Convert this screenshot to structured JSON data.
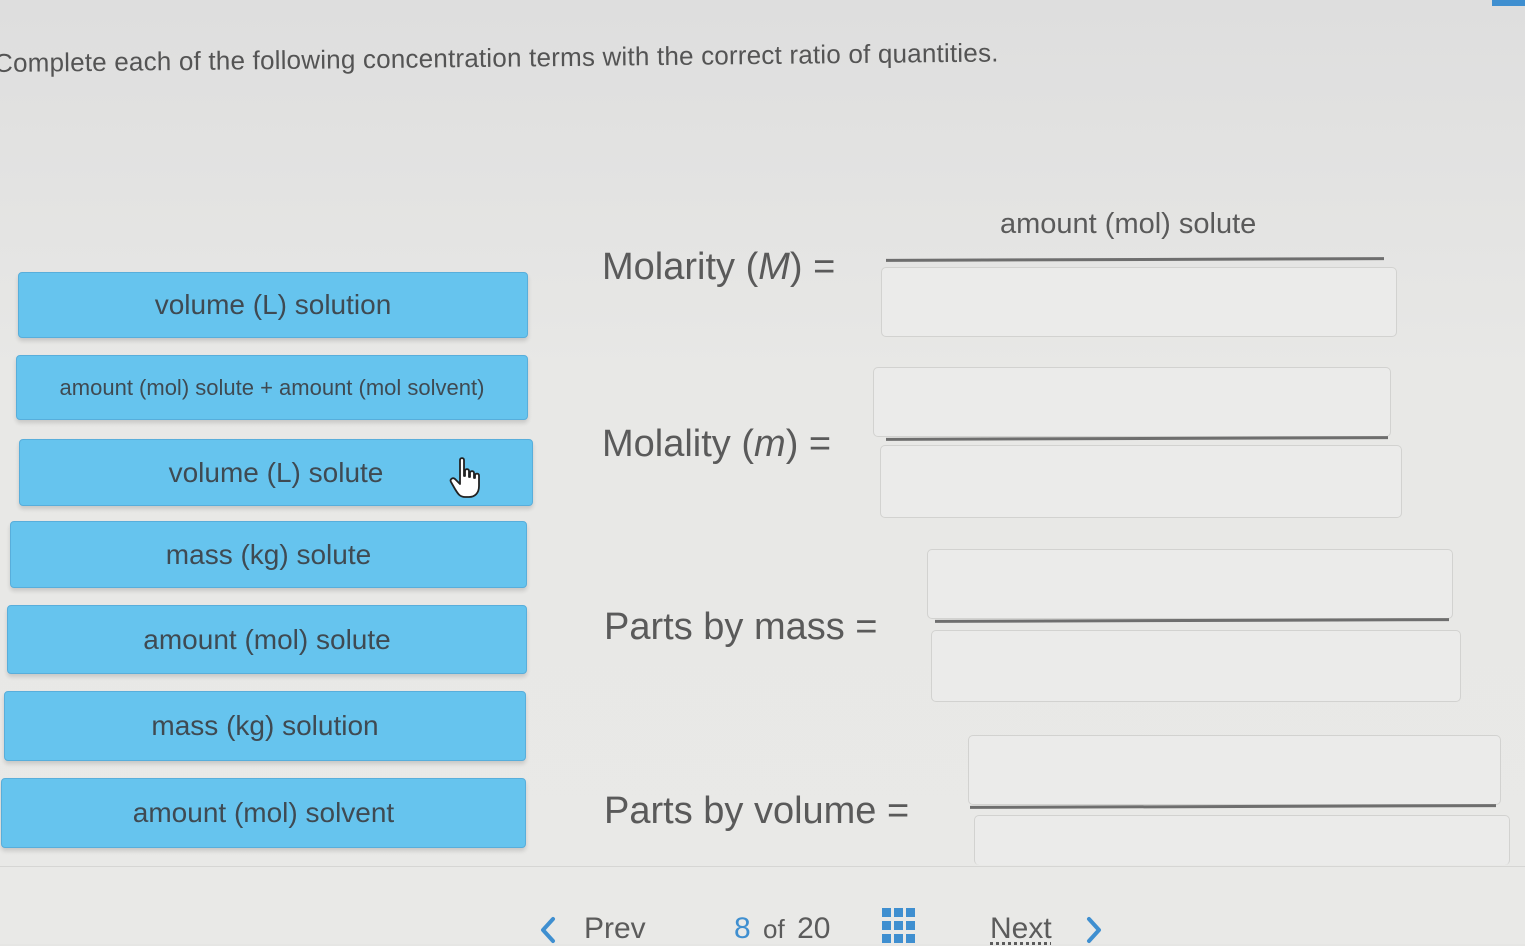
{
  "instruction": "Complete each of the following concentration terms with the correct ratio of quantities.",
  "tiles": [
    {
      "label": "volume (L) solution"
    },
    {
      "label": "amount (mol) solute + amount (mol solvent)"
    },
    {
      "label": "volume (L) solute"
    },
    {
      "label": "mass (kg) solute"
    },
    {
      "label": "amount (mol) solute"
    },
    {
      "label": "mass (kg) solution"
    },
    {
      "label": "amount (mol) solvent"
    }
  ],
  "equations": {
    "molarity": {
      "name": "Molarity (",
      "symbol": "M",
      "suffix": ") =",
      "numerator": "amount (mol) solute",
      "denominator": ""
    },
    "molality": {
      "name": "Molality (",
      "symbol": "m",
      "suffix": ") =",
      "numerator": "",
      "denominator": ""
    },
    "parts_by_mass": {
      "label": "Parts by mass =",
      "numerator": "",
      "denominator": ""
    },
    "parts_by_volume": {
      "label": "Parts by volume =",
      "numerator": "",
      "denominator": ""
    }
  },
  "footer": {
    "prev_label": "Prev",
    "page_current": "8",
    "page_of": "of",
    "page_total": "20",
    "next_label": "Next"
  },
  "colors": {
    "tile_fill": "#66c4ee",
    "accent": "#3f8fd0",
    "background": "#e8e8e6"
  },
  "icons": [
    "chevron-left-icon",
    "grid-icon",
    "chevron-right-icon",
    "hand-pointer-icon"
  ]
}
